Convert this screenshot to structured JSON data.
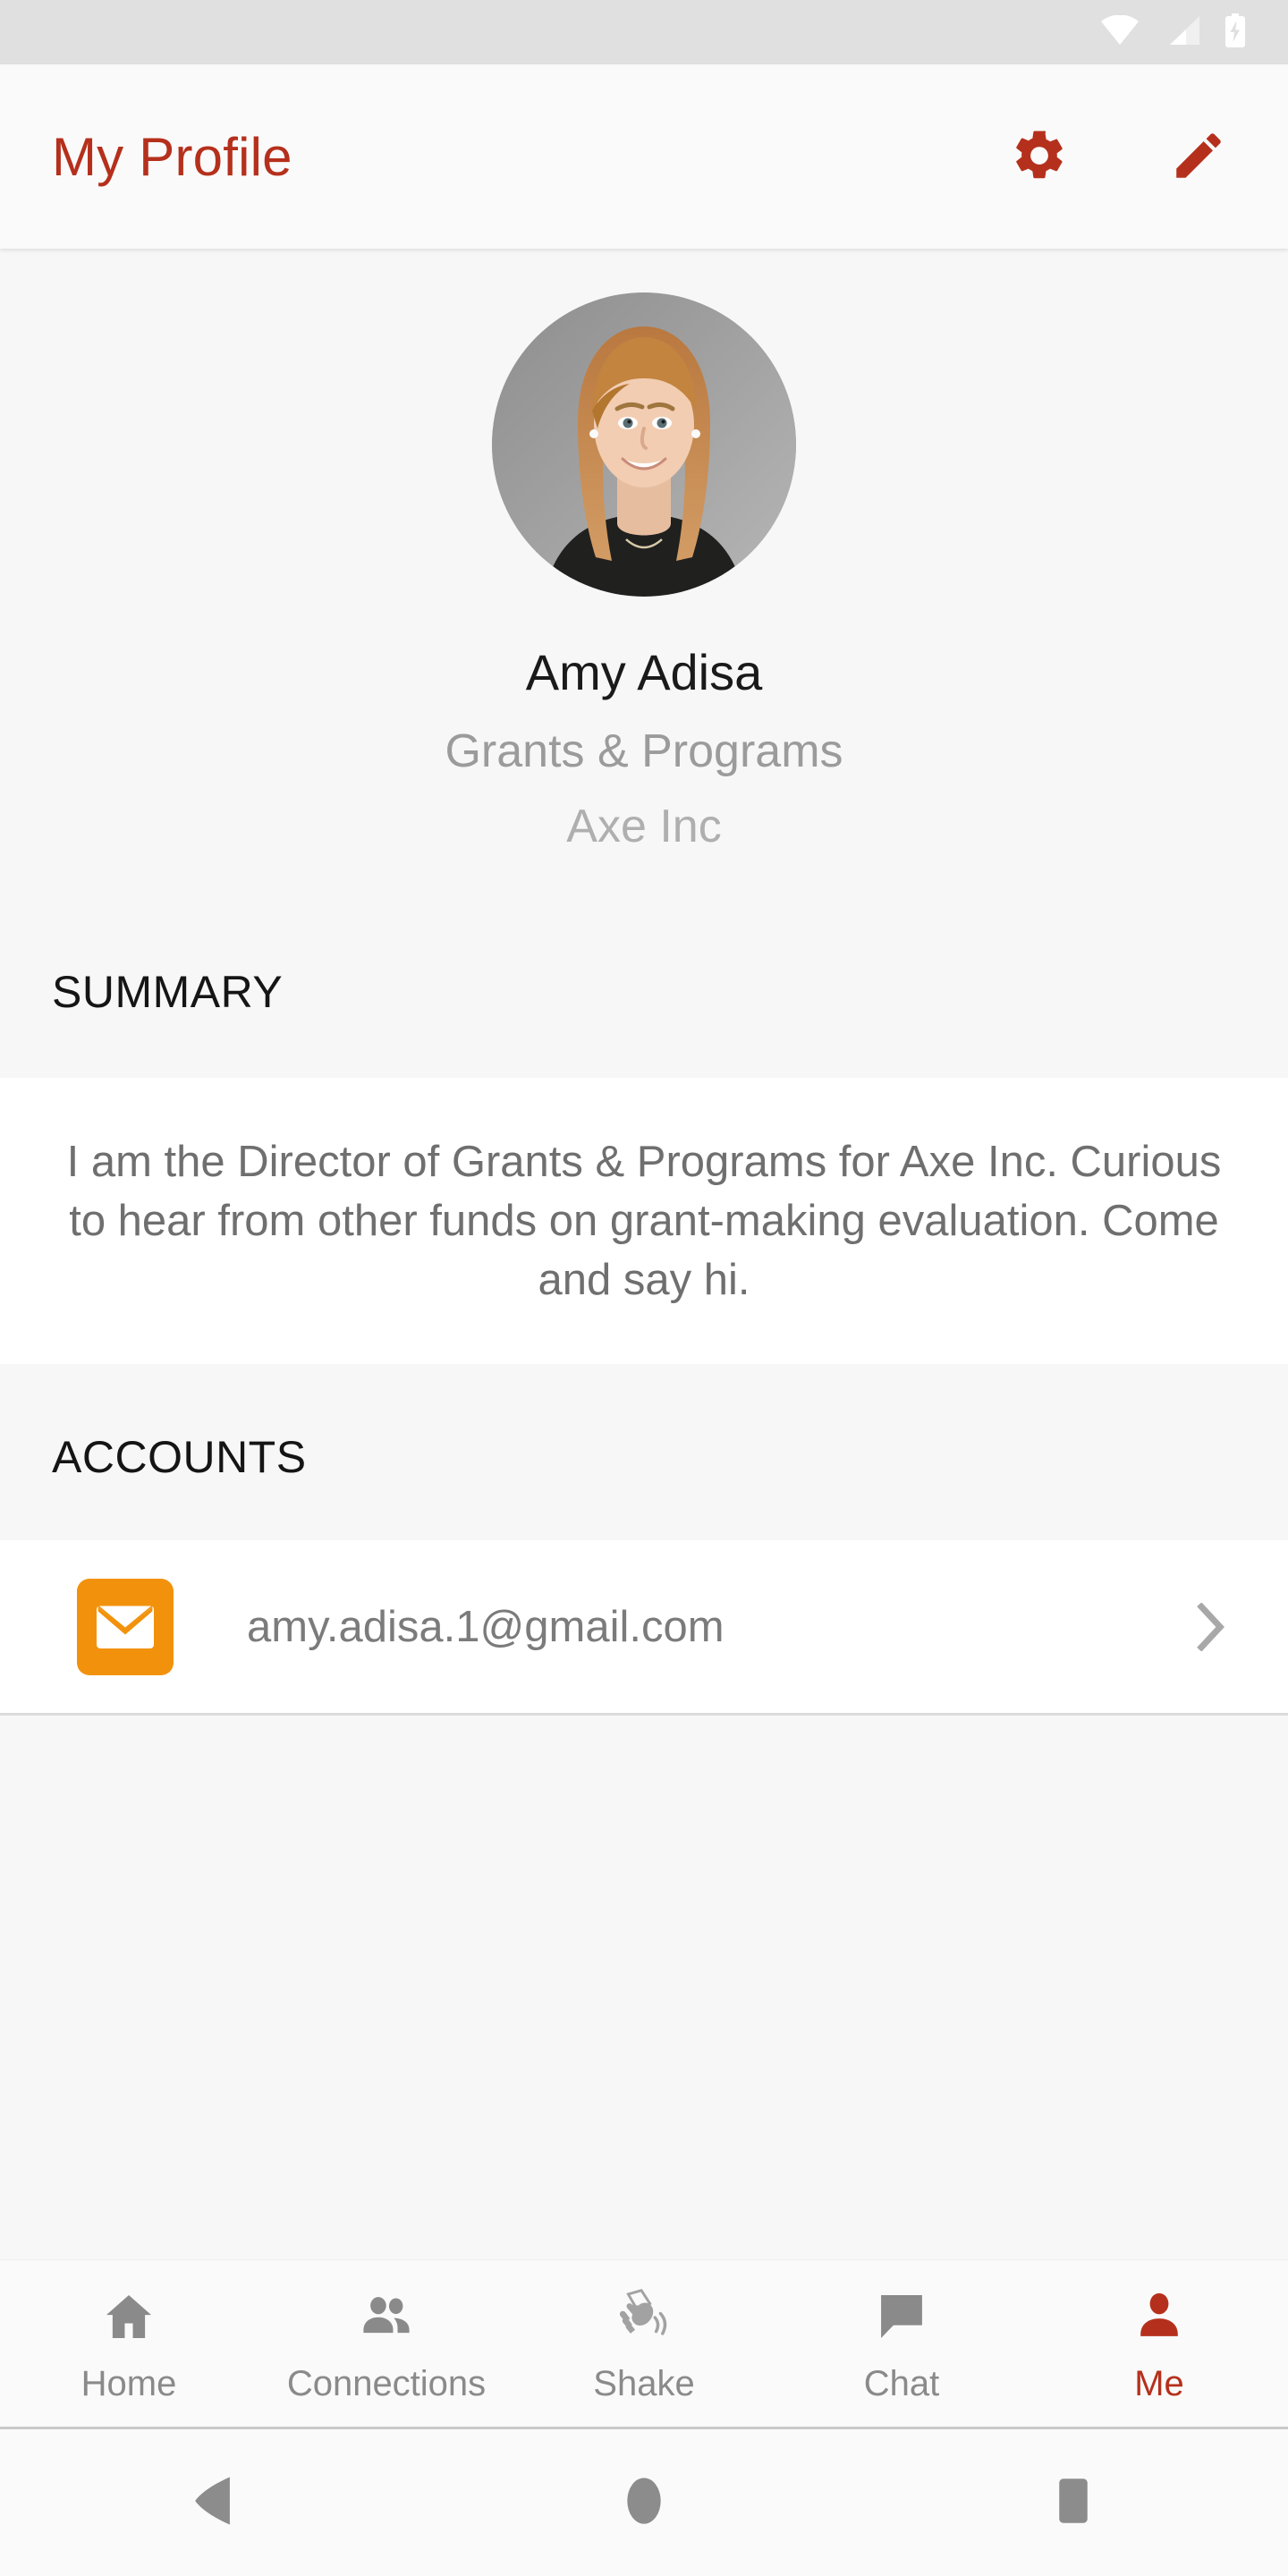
{
  "statusbar": {
    "icons": [
      "wifi-icon",
      "cellular-signal-icon",
      "battery-charging-icon"
    ]
  },
  "appbar": {
    "title": "My Profile",
    "actions": [
      {
        "name": "settings-button",
        "icon": "gear-icon"
      },
      {
        "name": "edit-profile-button",
        "icon": "pencil-icon"
      }
    ]
  },
  "profile": {
    "avatar_alt": "profile-photo",
    "name": "Amy Adisa",
    "role": "Grants & Programs",
    "organization": "Axe Inc"
  },
  "summary": {
    "header": "SUMMARY",
    "body": "I am the Director of Grants & Programs for Axe Inc. Curious to hear from other funds on grant-making evaluation. Come and say hi."
  },
  "accounts": {
    "header": "ACCOUNTS",
    "items": [
      {
        "icon": "email-icon",
        "icon_color": "#F2920C",
        "label": "amy.adisa.1@gmail.com",
        "chevron": "chevron-right-icon"
      }
    ]
  },
  "bottom_nav": {
    "items": [
      {
        "label": "Home",
        "icon": "home-icon",
        "active": false
      },
      {
        "label": "Connections",
        "icon": "people-icon",
        "active": false
      },
      {
        "label": "Shake",
        "icon": "shake-phone-icon",
        "active": false
      },
      {
        "label": "Chat",
        "icon": "chat-bubble-icon",
        "active": false
      },
      {
        "label": "Me",
        "icon": "person-icon",
        "active": true
      }
    ]
  },
  "system_nav": {
    "buttons": [
      "back-button",
      "home-button",
      "recents-button"
    ]
  },
  "colors": {
    "accent": "#B5301C",
    "page_background": "#F7F7F7",
    "card_background": "#FFFFFF",
    "status_bar": "#E0E0E0",
    "muted_text": "#9B9B9B",
    "email_icon": "#F2920C"
  }
}
